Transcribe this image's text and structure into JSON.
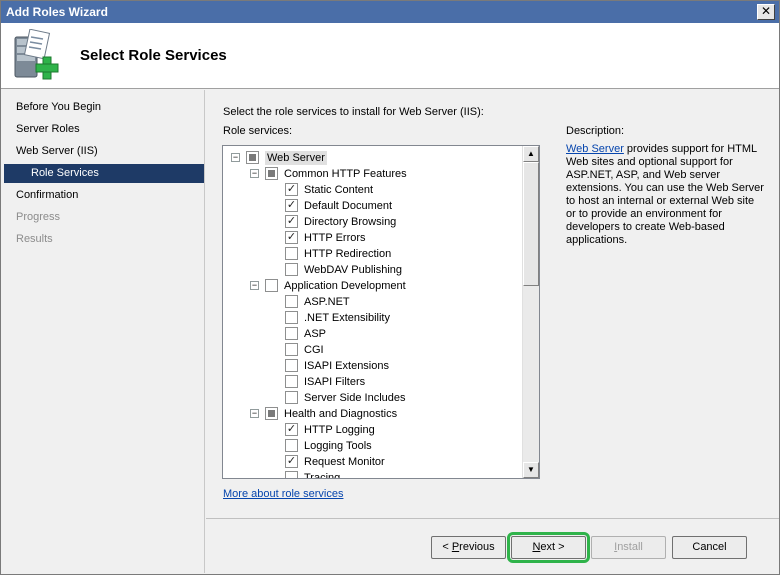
{
  "window": {
    "title": "Add Roles Wizard",
    "close_glyph": "✕"
  },
  "header": {
    "title": "Select Role Services",
    "icon": "server-add-icon"
  },
  "nav": {
    "items": [
      {
        "label": "Before You Begin",
        "state": "normal"
      },
      {
        "label": "Server Roles",
        "state": "normal"
      },
      {
        "label": "Web Server (IIS)",
        "state": "normal"
      },
      {
        "label": "Role Services",
        "state": "active"
      },
      {
        "label": "Confirmation",
        "state": "normal"
      },
      {
        "label": "Progress",
        "state": "disabled"
      },
      {
        "label": "Results",
        "state": "disabled"
      }
    ]
  },
  "main": {
    "instruction": "Select the role services to install for Web Server (IIS):",
    "role_services_label": "Role services:",
    "description_label": "Description:",
    "description_link": "Web Server",
    "description_text": " provides support for HTML Web sites and optional support for ASP.NET, ASP, and Web server extensions. You can use the Web Server to host an internal or external Web site or to provide an environment for developers to create Web-based applications.",
    "more_link": "More about role services"
  },
  "tree": [
    {
      "label": "Web Server",
      "level": 0,
      "expander": "−",
      "state": "partial",
      "highlight": true
    },
    {
      "label": "Common HTTP Features",
      "level": 1,
      "expander": "−",
      "state": "partial"
    },
    {
      "label": "Static Content",
      "level": 2,
      "state": "checked"
    },
    {
      "label": "Default Document",
      "level": 2,
      "state": "checked"
    },
    {
      "label": "Directory Browsing",
      "level": 2,
      "state": "checked"
    },
    {
      "label": "HTTP Errors",
      "level": 2,
      "state": "checked"
    },
    {
      "label": "HTTP Redirection",
      "level": 2,
      "state": "unchecked"
    },
    {
      "label": "WebDAV Publishing",
      "level": 2,
      "state": "unchecked"
    },
    {
      "label": "Application Development",
      "level": 1,
      "expander": "−",
      "state": "unchecked"
    },
    {
      "label": "ASP.NET",
      "level": 2,
      "state": "unchecked"
    },
    {
      "label": ".NET Extensibility",
      "level": 2,
      "state": "unchecked"
    },
    {
      "label": "ASP",
      "level": 2,
      "state": "unchecked"
    },
    {
      "label": "CGI",
      "level": 2,
      "state": "unchecked"
    },
    {
      "label": "ISAPI Extensions",
      "level": 2,
      "state": "unchecked"
    },
    {
      "label": "ISAPI Filters",
      "level": 2,
      "state": "unchecked"
    },
    {
      "label": "Server Side Includes",
      "level": 2,
      "state": "unchecked"
    },
    {
      "label": "Health and Diagnostics",
      "level": 1,
      "expander": "−",
      "state": "partial"
    },
    {
      "label": "HTTP Logging",
      "level": 2,
      "state": "checked"
    },
    {
      "label": "Logging Tools",
      "level": 2,
      "state": "unchecked"
    },
    {
      "label": "Request Monitor",
      "level": 2,
      "state": "checked"
    },
    {
      "label": "Tracing",
      "level": 2,
      "state": "unchecked"
    }
  ],
  "buttons": {
    "previous": {
      "mnemonic": "P",
      "before": "< ",
      "after": "revious"
    },
    "next": {
      "mnemonic": "N",
      "before": "",
      "after": "ext >"
    },
    "install": {
      "mnemonic": "I",
      "before": "",
      "after": "nstall"
    },
    "cancel": {
      "label": "Cancel"
    }
  },
  "scrollbar": {
    "up_glyph": "▲",
    "down_glyph": "▼"
  }
}
